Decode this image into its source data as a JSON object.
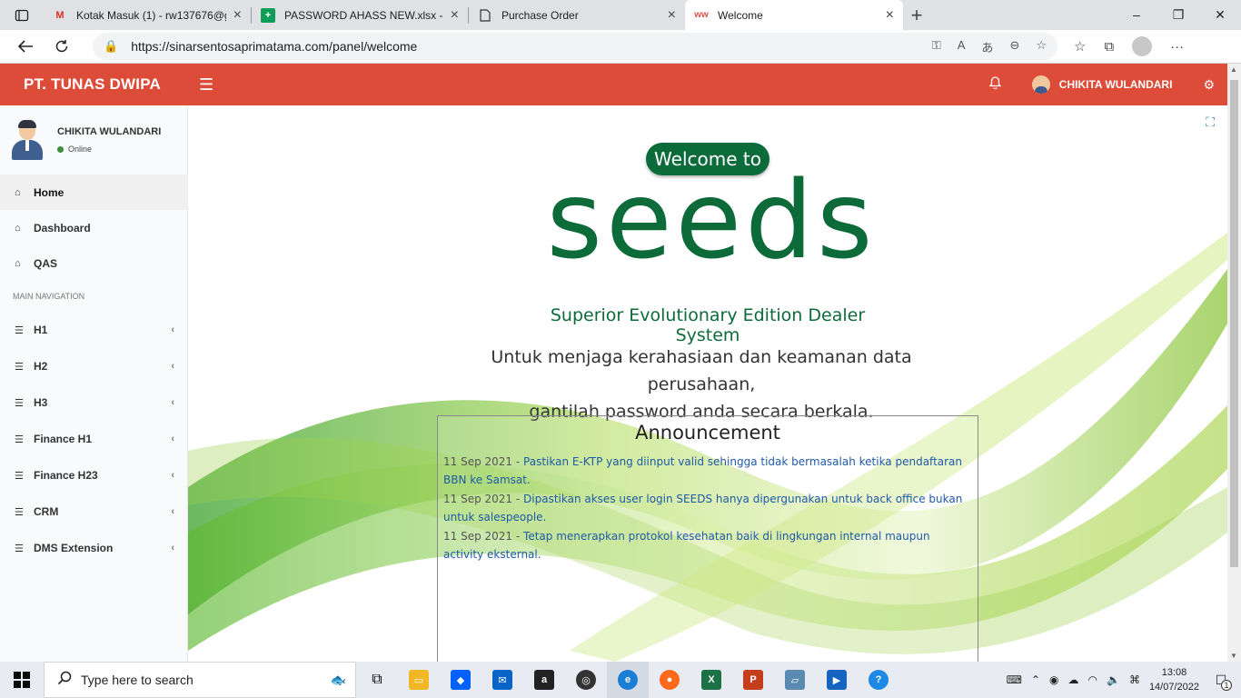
{
  "browser": {
    "tabs": [
      {
        "title": "Kotak Masuk (1) - rw137676@gm",
        "icon": "gmail-icon",
        "active": false
      },
      {
        "title": "PASSWORD AHASS NEW.xlsx - G",
        "icon": "sheets-icon",
        "active": false
      },
      {
        "title": "Purchase Order",
        "icon": "document-icon",
        "active": false
      },
      {
        "title": "Welcome",
        "icon": "site-icon",
        "active": true
      }
    ],
    "url": "https://sinarsentosaprimatama.com/panel/welcome"
  },
  "header": {
    "brand": "PT. TUNAS DWIPA",
    "user_name": "CHIKITA WULANDARI",
    "accent_color": "#dd4b39"
  },
  "sidebar": {
    "user": {
      "name": "CHIKITA WULANDARI",
      "status": "Online"
    },
    "top_items": [
      {
        "label": "Home",
        "icon": "home-icon"
      },
      {
        "label": "Dashboard",
        "icon": "home-icon"
      },
      {
        "label": "QAS",
        "icon": "home-icon"
      }
    ],
    "section_header": "MAIN NAVIGATION",
    "nav_items": [
      {
        "label": "H1",
        "icon": "database-icon"
      },
      {
        "label": "H2",
        "icon": "database-icon"
      },
      {
        "label": "H3",
        "icon": "database-icon"
      },
      {
        "label": "Finance H1",
        "icon": "database-icon"
      },
      {
        "label": "Finance H23",
        "icon": "database-icon"
      },
      {
        "label": "CRM",
        "icon": "database-icon"
      },
      {
        "label": "DMS Extension",
        "icon": "database-icon"
      }
    ]
  },
  "main": {
    "welcome": "Welcome to",
    "logo": "seeds",
    "logo_subtitle": "Superior Evolutionary Edition Dealer System",
    "tagline_1": "Untuk menjaga kerahasiaan dan keamanan data perusahaan,",
    "tagline_2": "gantilah password anda secara berkala.",
    "announcement": {
      "title": "Announcement",
      "items": [
        {
          "date": "11 Sep 2021",
          "text": "Pastikan E-KTP yang diinput valid sehingga tidak bermasalah ketika pendaftaran BBN ke Samsat."
        },
        {
          "date": "11 Sep 2021",
          "text": "Dipastikan akses user login SEEDS hanya dipergunakan untuk back office bukan untuk salespeople."
        },
        {
          "date": "11 Sep 2021",
          "text": "Tetap menerapkan protokol kesehatan baik di lingkungan internal maupun activity eksternal."
        }
      ]
    }
  },
  "taskbar": {
    "search_placeholder": "Type here to search",
    "time": "13:08",
    "date": "14/07/2022",
    "notification_count": "1"
  }
}
